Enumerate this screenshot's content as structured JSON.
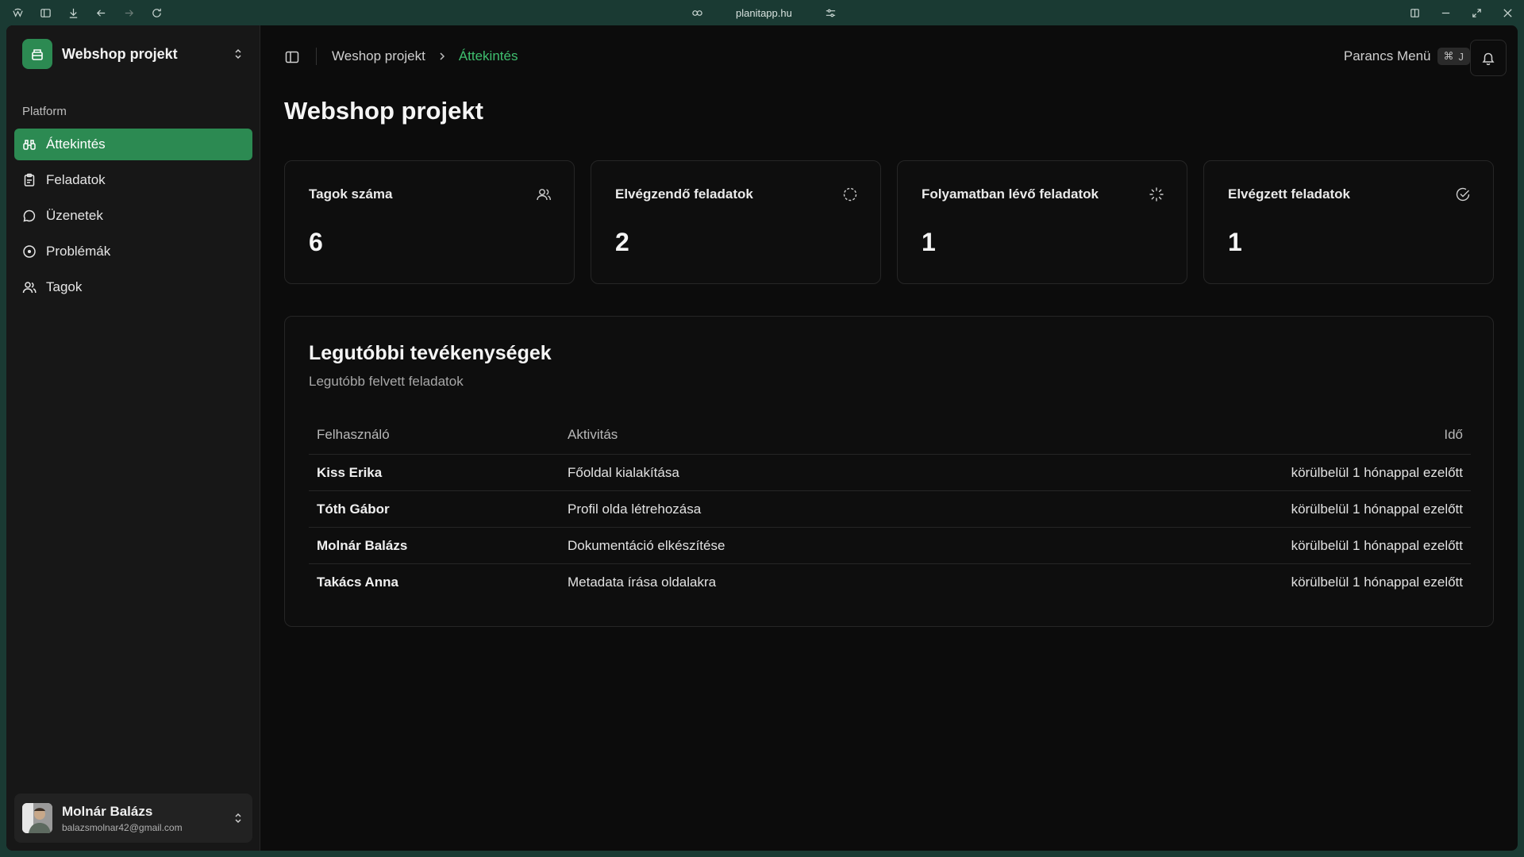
{
  "browser": {
    "url": "planitapp.hu"
  },
  "sidebar": {
    "project_name": "Webshop projekt",
    "section_label": "Platform",
    "items": [
      {
        "label": "Áttekintés",
        "icon": "binoculars-icon",
        "active": true
      },
      {
        "label": "Feladatok",
        "icon": "clipboard-icon",
        "active": false
      },
      {
        "label": "Üzenetek",
        "icon": "message-circle-icon",
        "active": false
      },
      {
        "label": "Problémák",
        "icon": "alert-circle-icon",
        "active": false
      },
      {
        "label": "Tagok",
        "icon": "users-icon",
        "active": false
      }
    ],
    "user": {
      "name": "Molnár Balázs",
      "email": "balazsmolnar42@gmail.com"
    }
  },
  "header": {
    "breadcrumb": [
      "Weshop projekt",
      "Áttekintés"
    ],
    "command_menu_label": "Parancs Menü",
    "command_menu_shortcut_symbol": "⌘",
    "command_menu_shortcut_key": "J"
  },
  "main": {
    "title": "Webshop projekt",
    "stats": [
      {
        "label": "Tagok száma",
        "value": "6",
        "icon": "users-icon"
      },
      {
        "label": "Elvégzendő feladatok",
        "value": "2",
        "icon": "circle-dashed-icon"
      },
      {
        "label": "Folyamatban lévő feladatok",
        "value": "1",
        "icon": "loader-icon"
      },
      {
        "label": "Elvégzett feladatok",
        "value": "1",
        "icon": "circle-check-icon"
      }
    ],
    "activity": {
      "title": "Legutóbbi tevékenységek",
      "subtitle": "Legutóbb felvett feladatok",
      "columns": [
        "Felhasználó",
        "Aktivitás",
        "Idő"
      ],
      "rows": [
        {
          "user": "Kiss Erika",
          "activity": "Főoldal kialakítása",
          "time": "körülbelül 1 hónappal ezelőtt"
        },
        {
          "user": "Tóth Gábor",
          "activity": "Profil olda létrehozása",
          "time": "körülbelül 1 hónappal ezelőtt"
        },
        {
          "user": "Molnár Balázs",
          "activity": "Dokumentáció elkészítése",
          "time": "körülbelül 1 hónappal ezelőtt"
        },
        {
          "user": "Takács Anna",
          "activity": "Metadata írása oldalakra",
          "time": "körülbelül 1 hónappal ezelőtt"
        }
      ]
    }
  },
  "colors": {
    "accent": "#2c8a52",
    "accent_text": "#3fbf6f",
    "background": "#0c0c0c",
    "sidebar": "#171717"
  }
}
